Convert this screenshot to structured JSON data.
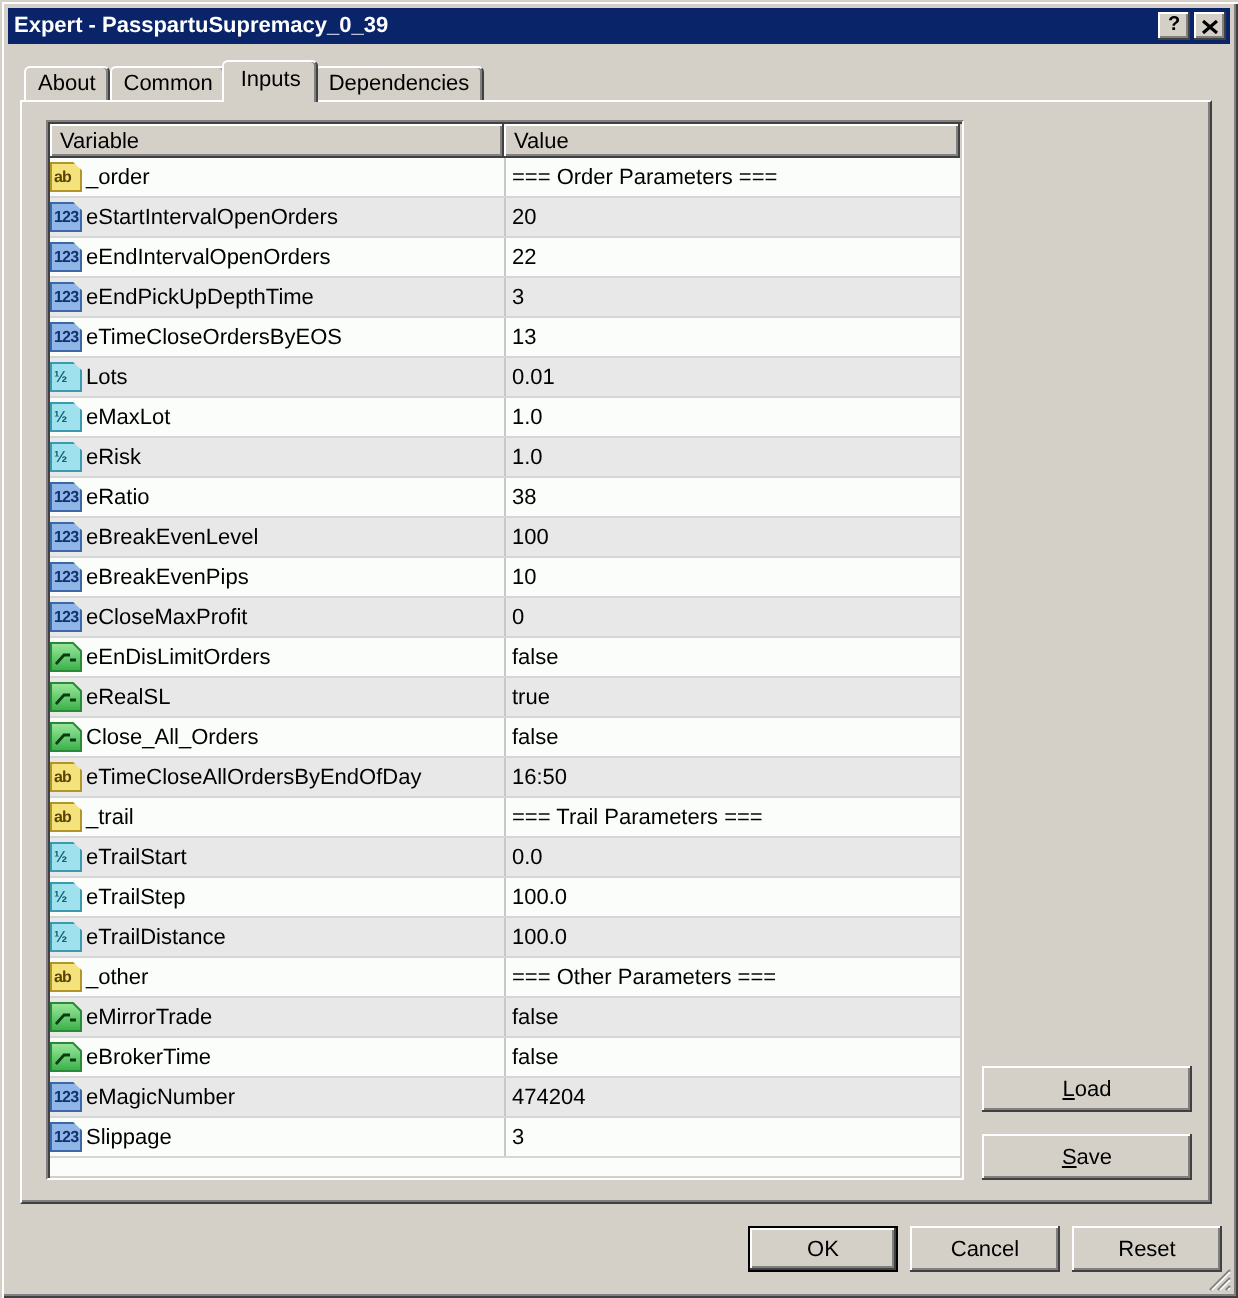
{
  "window": {
    "title": "Expert - PasspartuSupremacy_0_39",
    "help_button": "?"
  },
  "tabs": [
    {
      "label": "About",
      "selected": false
    },
    {
      "label": "Common",
      "selected": false
    },
    {
      "label": "Inputs",
      "selected": true
    },
    {
      "label": "Dependencies",
      "selected": false
    }
  ],
  "table": {
    "columns": [
      "Variable",
      "Value"
    ],
    "rows": [
      {
        "kind": "string",
        "badge": "ab",
        "variable": "_order",
        "value": "=== Order Parameters ==="
      },
      {
        "kind": "int",
        "badge": "123",
        "variable": "eStartIntervalOpenOrders",
        "value": "20"
      },
      {
        "kind": "int",
        "badge": "123",
        "variable": "eEndIntervalOpenOrders",
        "value": "22"
      },
      {
        "kind": "int",
        "badge": "123",
        "variable": "eEndPickUpDepthTime",
        "value": "3"
      },
      {
        "kind": "int",
        "badge": "123",
        "variable": "eTimeCloseOrdersByEOS",
        "value": "13"
      },
      {
        "kind": "double",
        "badge": "½",
        "variable": "Lots",
        "value": "0.01"
      },
      {
        "kind": "double",
        "badge": "½",
        "variable": "eMaxLot",
        "value": "1.0"
      },
      {
        "kind": "double",
        "badge": "½",
        "variable": "eRisk",
        "value": "1.0"
      },
      {
        "kind": "int",
        "badge": "123",
        "variable": "eRatio",
        "value": "38"
      },
      {
        "kind": "int",
        "badge": "123",
        "variable": "eBreakEvenLevel",
        "value": "100"
      },
      {
        "kind": "int",
        "badge": "123",
        "variable": "eBreakEvenPips",
        "value": "10"
      },
      {
        "kind": "int",
        "badge": "123",
        "variable": "eCloseMaxProfit",
        "value": "0"
      },
      {
        "kind": "bool",
        "variable": "eEnDisLimitOrders",
        "value": "false"
      },
      {
        "kind": "bool",
        "variable": "eRealSL",
        "value": "true"
      },
      {
        "kind": "bool",
        "variable": "Close_All_Orders",
        "value": "false"
      },
      {
        "kind": "string",
        "badge": "ab",
        "variable": "eTimeCloseAllOrdersByEndOfDay",
        "value": "16:50"
      },
      {
        "kind": "string",
        "badge": "ab",
        "variable": "_trail",
        "value": "=== Trail Parameters ==="
      },
      {
        "kind": "double",
        "badge": "½",
        "variable": "eTrailStart",
        "value": "0.0"
      },
      {
        "kind": "double",
        "badge": "½",
        "variable": "eTrailStep",
        "value": "100.0"
      },
      {
        "kind": "double",
        "badge": "½",
        "variable": "eTrailDistance",
        "value": "100.0"
      },
      {
        "kind": "string",
        "badge": "ab",
        "variable": "_other",
        "value": "=== Other Parameters ==="
      },
      {
        "kind": "bool",
        "variable": "eMirrorTrade",
        "value": "false"
      },
      {
        "kind": "bool",
        "variable": "eBrokerTime",
        "value": "false"
      },
      {
        "kind": "int",
        "badge": "123",
        "variable": "eMagicNumber",
        "value": "474204"
      },
      {
        "kind": "int",
        "badge": "123",
        "variable": "Slippage",
        "value": "3"
      }
    ]
  },
  "side_buttons": [
    {
      "label": "Load",
      "mnemonic_underlined": true
    },
    {
      "label": "Save",
      "mnemonic_underlined": true
    }
  ],
  "buttons": [
    {
      "label": "OK",
      "default": true
    },
    {
      "label": "Cancel",
      "default": false
    },
    {
      "label": "Reset",
      "default": false
    }
  ]
}
